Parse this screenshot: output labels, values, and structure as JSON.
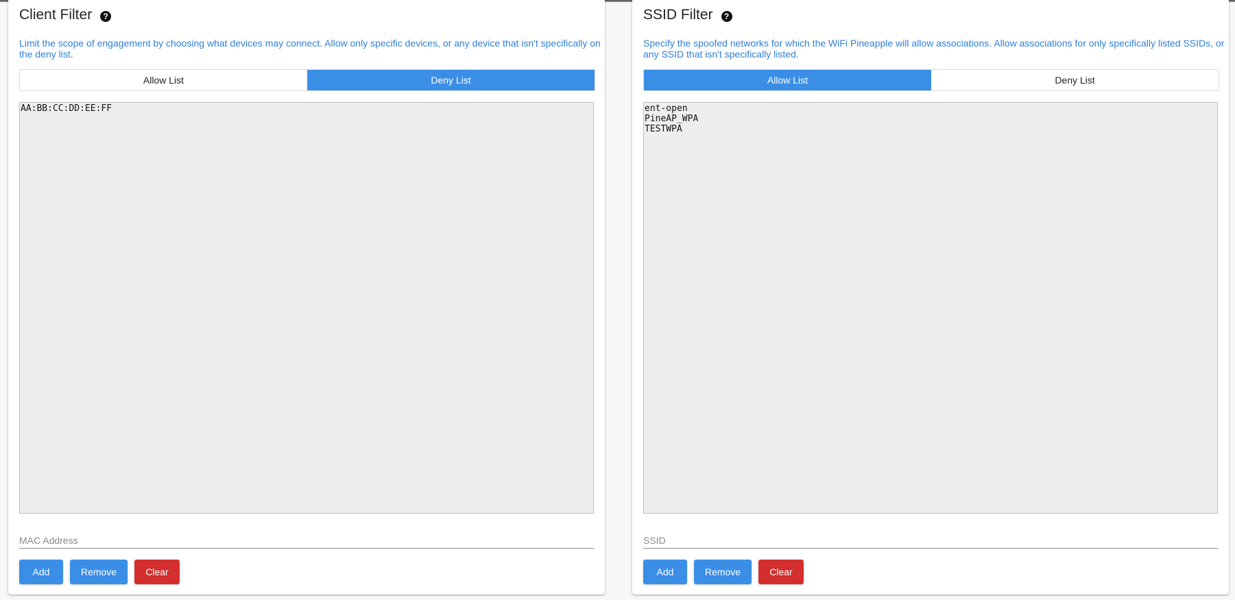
{
  "client_filter": {
    "title": "Client Filter",
    "help_icon": "question-circle-icon",
    "description": "Limit the scope of engagement by choosing what devices may connect. Allow only specific devices, or any device that isn't specifically on the deny list.",
    "tabs": [
      {
        "label": "Allow List",
        "active": false
      },
      {
        "label": "Deny List",
        "active": true
      }
    ],
    "list_content": "AA:BB:CC:DD:EE:FF",
    "input_placeholder": "MAC Address",
    "input_value": "",
    "buttons": {
      "add": "Add",
      "remove": "Remove",
      "clear": "Clear"
    }
  },
  "ssid_filter": {
    "title": "SSID Filter",
    "help_icon": "question-circle-icon",
    "description": "Specify the spoofed networks for which the WiFi Pineapple will allow associations. Allow associations for only specifically listed SSIDs, or any SSID that isn't specifically listed.",
    "tabs": [
      {
        "label": "Allow List",
        "active": true
      },
      {
        "label": "Deny List",
        "active": false
      }
    ],
    "list_content": "ent-open\nPineAP_WPA\nTESTWPA",
    "input_placeholder": "SSID",
    "input_value": "",
    "buttons": {
      "add": "Add",
      "remove": "Remove",
      "clear": "Clear"
    }
  },
  "colors": {
    "accent": "#3a8ee6",
    "danger": "#d32f2f",
    "description_text": "#2f7fd6",
    "list_background": "#eeeeee"
  }
}
